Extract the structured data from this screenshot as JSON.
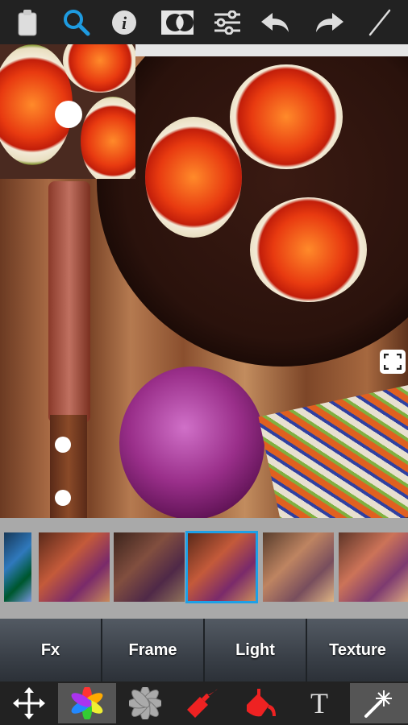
{
  "toolbar": {
    "icons": [
      "clipboard-icon",
      "search-icon",
      "info-icon",
      "compare-icon",
      "sliders-icon",
      "undo-icon",
      "redo-icon",
      "brush-icon"
    ],
    "active": "search-icon",
    "accent": "#1e9be0"
  },
  "filmstrip": {
    "selected_index": 3,
    "selection_color": "#1ea0e6"
  },
  "tabs": [
    {
      "label": "Fx"
    },
    {
      "label": "Frame"
    },
    {
      "label": "Light"
    },
    {
      "label": "Texture"
    }
  ],
  "bottom_tools": {
    "icons": [
      "move-icon",
      "color-pinwheel-icon",
      "gray-flower-icon",
      "paint-brush-icon",
      "paint-bucket-icon",
      "text-icon",
      "magic-wand-icon"
    ],
    "text_tool_glyph": "T",
    "active": [
      "color-pinwheel-icon",
      "magic-wand-icon"
    ]
  }
}
